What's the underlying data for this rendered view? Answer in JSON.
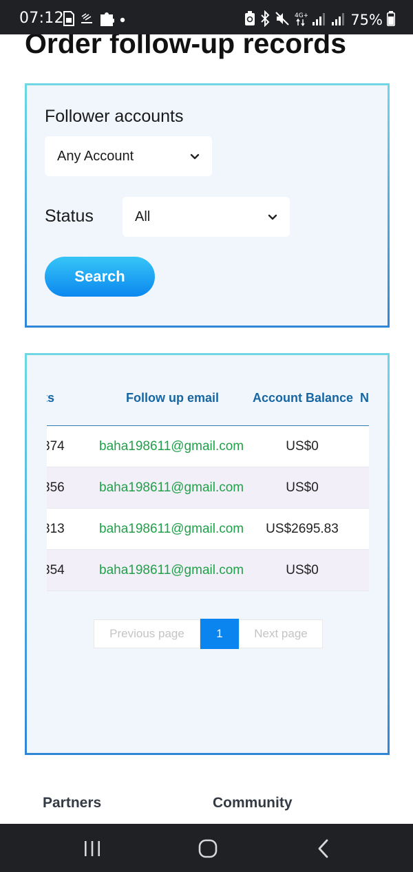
{
  "status_bar": {
    "time": "07:12",
    "battery": "75%",
    "left_icons": [
      "sim-card-icon",
      "ai-assistant-icon",
      "puzzle-icon",
      "dot-icon"
    ],
    "right_icons": [
      "battery-saver-icon",
      "bluetooth-icon",
      "mute-icon",
      "network-4g-icon",
      "signal-icon",
      "signal-icon",
      "battery-icon"
    ]
  },
  "page": {
    "title": "Order follow-up records"
  },
  "filters": {
    "account_label": "Follower accounts",
    "account_selected": "Any Account",
    "status_label": "Status",
    "status_selected": "All",
    "search_label": "Search"
  },
  "table": {
    "headers": [
      "ccounts",
      "Follow up email",
      "Account Balance",
      "N"
    ],
    "rows": [
      {
        "account": "374",
        "email": "baha198611@gmail.com",
        "balance": "US$0"
      },
      {
        "account": "356",
        "email": "baha198611@gmail.com",
        "balance": "US$0"
      },
      {
        "account": "313",
        "email": "baha198611@gmail.com",
        "balance": "US$2695.83"
      },
      {
        "account": "354",
        "email": "baha198611@gmail.com",
        "balance": "US$0"
      }
    ]
  },
  "pagination": {
    "previous": "Previous page",
    "current": "1",
    "next": "Next page"
  },
  "footer": {
    "links": [
      "Partners",
      "Community"
    ]
  },
  "nav_bar": {
    "buttons": [
      "recent-apps-icon",
      "home-icon",
      "back-icon"
    ]
  },
  "colors": {
    "accent_blue": "#0a84ee",
    "header_text": "#1566a3",
    "email_green": "#21a04a",
    "panel_bg": "#f1f6fd"
  }
}
